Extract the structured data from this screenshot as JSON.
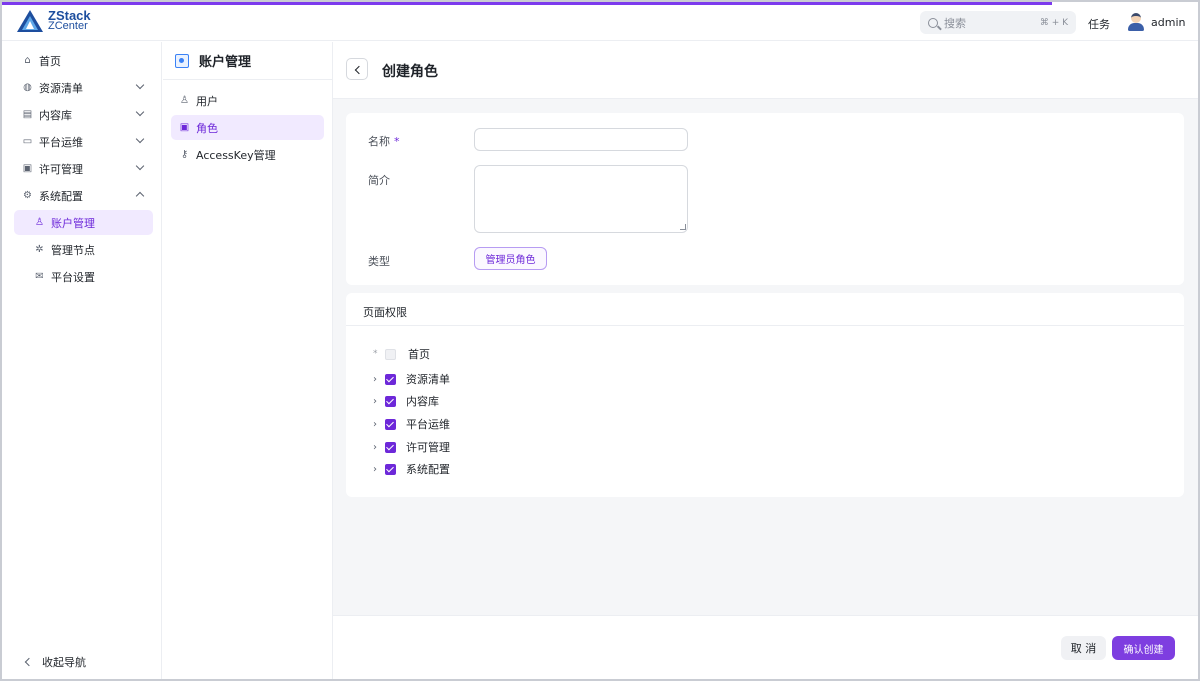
{
  "app": {
    "logo_line1": "ZStack",
    "logo_line2": "ZCenter"
  },
  "header": {
    "search_placeholder": "搜索",
    "search_shortcut": "⌘ + K",
    "tasks": "任务",
    "username": "admin"
  },
  "sidebar": {
    "items": [
      {
        "label": "首页",
        "icon": "home-icon"
      },
      {
        "label": "资源清单",
        "icon": "globe-icon"
      },
      {
        "label": "内容库",
        "icon": "library-icon"
      },
      {
        "label": "平台运维",
        "icon": "monitor-icon"
      },
      {
        "label": "许可管理",
        "icon": "license-icon"
      },
      {
        "label": "系统配置",
        "icon": "gear-icon"
      },
      {
        "label": "账户管理",
        "icon": "user-icon"
      },
      {
        "label": "管理节点",
        "icon": "node-icon"
      },
      {
        "label": "平台设置",
        "icon": "mail-icon"
      }
    ],
    "collapse_label": "收起导航"
  },
  "subpanel": {
    "title": "账户管理",
    "items": [
      {
        "label": "用户",
        "icon": "user-icon"
      },
      {
        "label": "角色",
        "icon": "role-icon"
      },
      {
        "label": "AccessKey管理",
        "icon": "key-icon"
      }
    ]
  },
  "page": {
    "title": "创建角色",
    "form": {
      "name_label": "名称",
      "required_mark": "*",
      "name_value": "",
      "desc_label": "简介",
      "desc_value": "",
      "type_label": "类型",
      "type_value": "管理员角色"
    },
    "permissions": {
      "title": "页面权限",
      "required_mark": "*",
      "tree": [
        {
          "label": "首页",
          "checked": false,
          "disabled": true
        },
        {
          "label": "资源清单",
          "checked": true
        },
        {
          "label": "内容库",
          "checked": true
        },
        {
          "label": "平台运维",
          "checked": true
        },
        {
          "label": "许可管理",
          "checked": true
        },
        {
          "label": "系统配置",
          "checked": true
        }
      ]
    },
    "footer": {
      "cancel": "取 消",
      "confirm": "确认创建"
    }
  },
  "colors": {
    "accent": "#7e3ee0",
    "accent_light": "#f1eaff",
    "brand": "#1d4e9e"
  }
}
